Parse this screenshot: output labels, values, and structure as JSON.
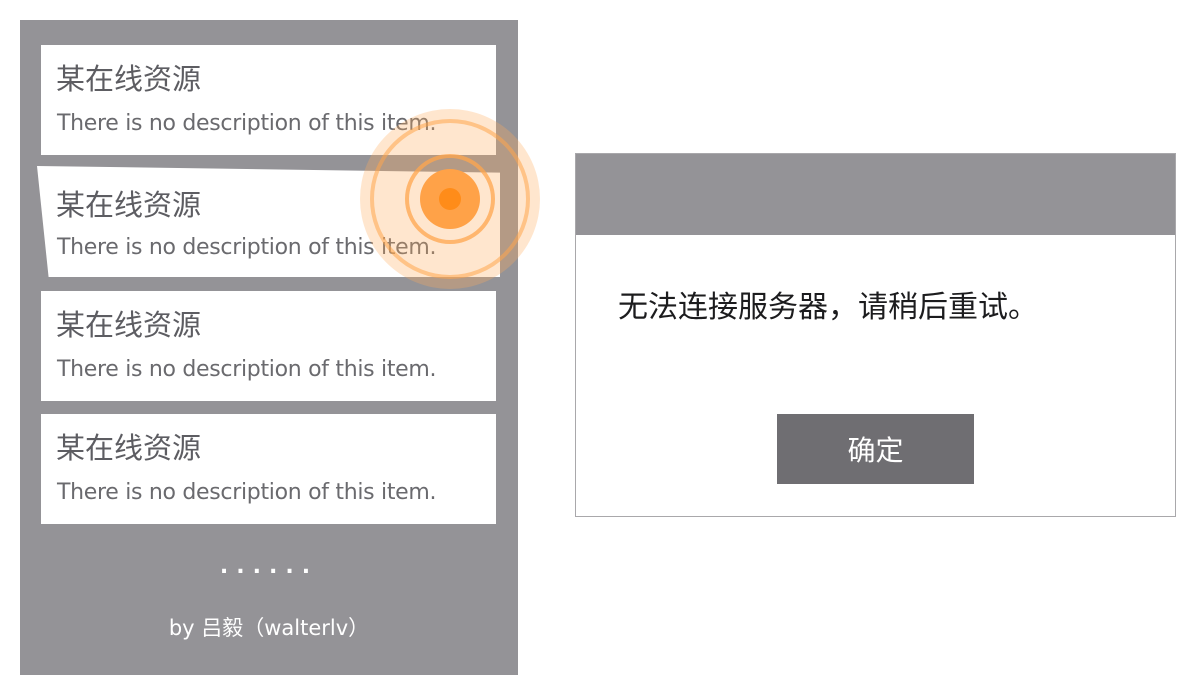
{
  "list": {
    "items": [
      {
        "title": "某在线资源",
        "description": "There is no description of this item."
      },
      {
        "title": "某在线资源",
        "description": "There is no description of this item."
      },
      {
        "title": "某在线资源",
        "description": "There is no description of this item."
      },
      {
        "title": "某在线资源",
        "description": "There is no description of this item."
      }
    ],
    "more_indicator": "......",
    "byline": "by 吕毅（walterlv）"
  },
  "dialog": {
    "header_title": "",
    "message": "无法连接服务器，请稍后重试。",
    "ok_label": "确定"
  },
  "colors": {
    "panel_bg": "#949397",
    "dialog_header": "#949397",
    "button_bg": "#6f6e72",
    "touch_accent": "#ff8c19"
  }
}
